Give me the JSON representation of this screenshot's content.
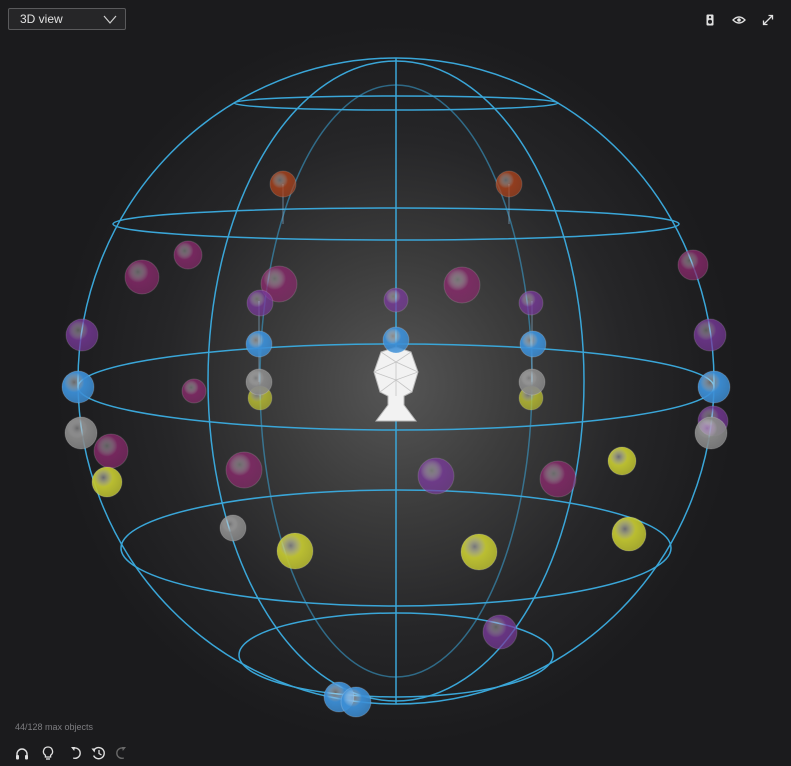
{
  "view_selector": {
    "value": "3D view"
  },
  "toolbar": {
    "speaker_icon": "speaker-icon",
    "visibility_icon": "eye-icon",
    "fullscreen_icon": "expand-icon"
  },
  "status": {
    "object_count": "44/128 max objects"
  },
  "bottom_toolbar": {
    "headphones_icon": "headphones-icon",
    "lightbulb_icon": "lightbulb-icon",
    "undo_icon": "undo-icon",
    "history_icon": "history-icon",
    "redo_icon": "redo-icon"
  },
  "colors": {
    "wireframe": "#3aa6d8",
    "blue": "#3d8fd6",
    "purple": "#7a3a9c",
    "magenta": "#8c2a6e",
    "yellow": "#c2c632",
    "gray": "#8a8a8a",
    "orange": "#b0441c",
    "toolbar_icon": "#e0e0e0",
    "disabled_icon": "#6a6a6a"
  },
  "objects": [
    {
      "color": "orange"
    },
    {
      "color": "orange"
    },
    {
      "color": "magenta"
    },
    {
      "color": "magenta"
    },
    {
      "color": "magenta"
    },
    {
      "color": "purple"
    },
    {
      "color": "purple"
    },
    {
      "color": "magenta"
    },
    {
      "color": "purple"
    },
    {
      "color": "magenta"
    },
    {
      "color": "purple"
    },
    {
      "color": "purple"
    },
    {
      "color": "blue"
    },
    {
      "color": "blue"
    },
    {
      "color": "blue"
    },
    {
      "color": "blue"
    },
    {
      "color": "blue"
    },
    {
      "color": "gray"
    },
    {
      "color": "gray"
    },
    {
      "color": "yellow"
    },
    {
      "color": "yellow"
    },
    {
      "color": "magenta"
    },
    {
      "color": "gray"
    },
    {
      "color": "magenta"
    },
    {
      "color": "purple"
    },
    {
      "color": "gray"
    },
    {
      "color": "yellow"
    },
    {
      "color": "magenta"
    },
    {
      "color": "purple"
    },
    {
      "color": "magenta"
    },
    {
      "color": "yellow"
    },
    {
      "color": "yellow"
    },
    {
      "color": "gray"
    },
    {
      "color": "yellow"
    },
    {
      "color": "yellow"
    },
    {
      "color": "purple"
    },
    {
      "color": "blue"
    },
    {
      "color": "blue"
    }
  ]
}
